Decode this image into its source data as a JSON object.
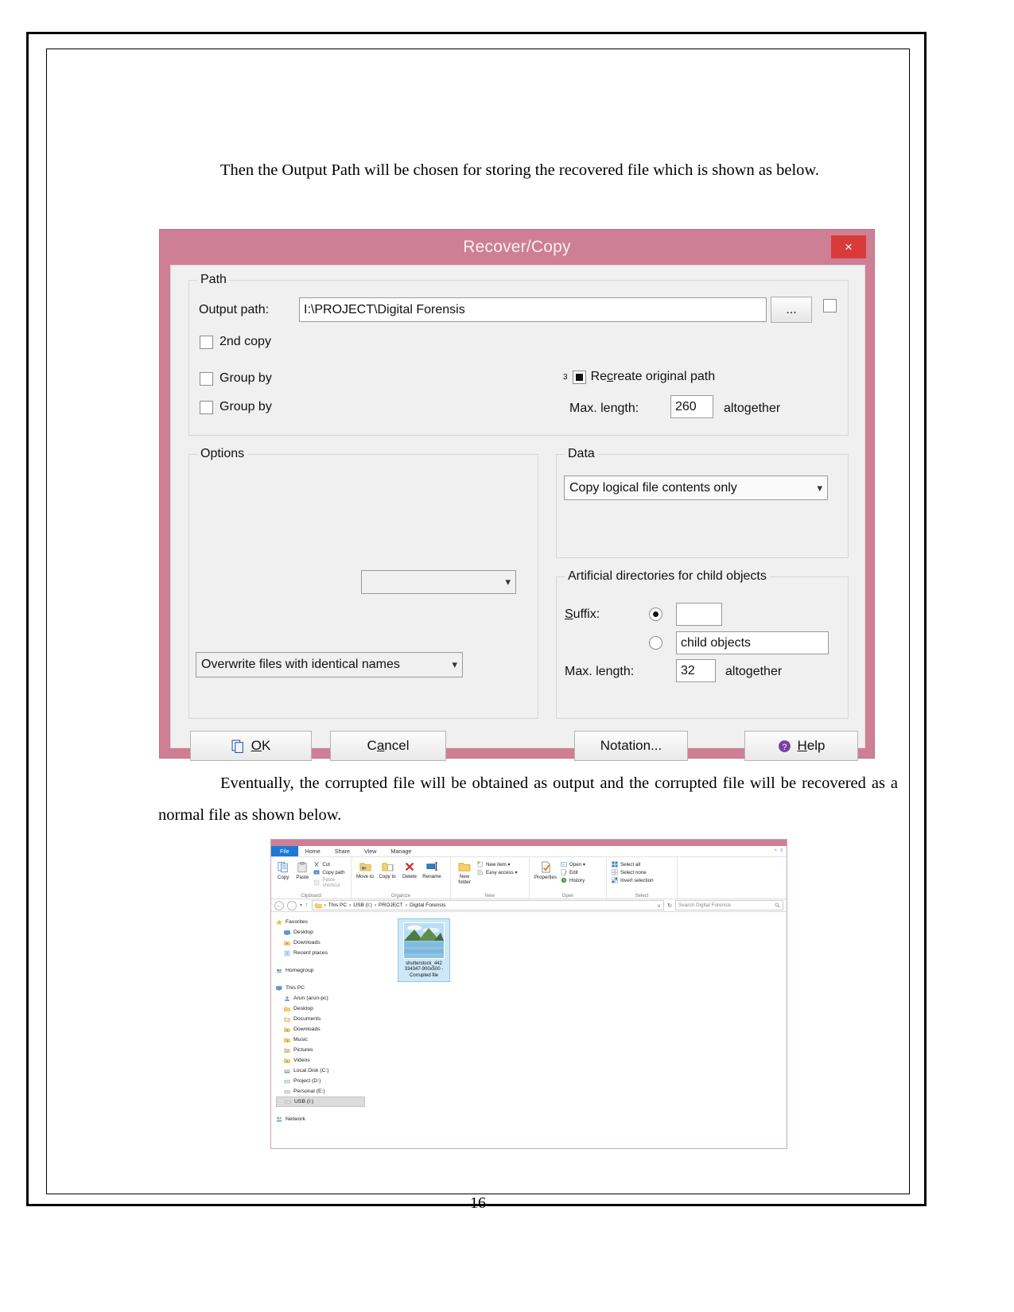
{
  "document": {
    "paragraph1_indent": "",
    "paragraph1": "Then the Output Path will be chosen for storing the recovered file which is shown as below.",
    "paragraph2": "Eventually, the corrupted file will be obtained as output and the corrupted file will be recovered as a normal file as shown below.",
    "page_number": "16"
  },
  "dialog": {
    "title": "Recover/Copy",
    "close_label": "×",
    "titlebar_color": "#cf7f95",
    "close_color": "#d93b3b",
    "path_group": {
      "label": "Path",
      "output_path_label": "Output path:",
      "output_path_value": "I:\\PROJECT\\Digital Forensis",
      "browse_label": "...",
      "second_copy_label": "2nd copy",
      "group_by_label_1": "Group by",
      "group_by_label_2": "Group by",
      "recreate_superscript": "3",
      "recreate_label": "Recreate original path",
      "recreate_label_prefix": "Re",
      "recreate_label_accel": "c",
      "recreate_label_suffix": "reate original path",
      "max_length_label": "Max. length:",
      "max_length_value": "260",
      "altogether_label": "altogether"
    },
    "options_group": {
      "label": "Options",
      "empty_combo_value": "",
      "overwrite_combo_value": "Overwrite files with identical names"
    },
    "data_group": {
      "label": "Data",
      "copy_mode_value": "Copy logical file contents only"
    },
    "artificial_group": {
      "label": "Artificial directories for child objects",
      "suffix_label": "Suffix:",
      "suffix_label_accel": "S",
      "suffix_label_rest": "uffix:",
      "suffix_value": "",
      "child_objects_value": "child objects",
      "max_length_label": "Max. length:",
      "max_length_value": "32",
      "altogether_label": "altogether"
    },
    "buttons": {
      "ok": "OK",
      "ok_accel": "O",
      "ok_rest": "K",
      "cancel": "Cancel",
      "cancel_pre": "C",
      "cancel_accel": "a",
      "cancel_rest": "ncel",
      "notation": "Notation...",
      "help": "Help",
      "help_accel": "H",
      "help_rest": "elp"
    }
  },
  "explorer": {
    "tabs": [
      {
        "label": "File",
        "state": "file"
      },
      {
        "label": "Home",
        "state": "active"
      },
      {
        "label": "Share",
        "state": "normal"
      },
      {
        "label": "View",
        "state": "normal"
      },
      {
        "label": "Manage",
        "state": "contextual"
      }
    ],
    "ribbon_groups": [
      {
        "name": "Clipboard",
        "big": [
          {
            "label": "Copy",
            "icon": "copy-icon"
          },
          {
            "label": "Paste",
            "icon": "paste-icon"
          }
        ],
        "small": [
          {
            "label": "Cut",
            "icon": "cut-icon"
          },
          {
            "label": "Copy path",
            "icon": "copy-path-icon"
          },
          {
            "label": "Paste shortcut",
            "icon": "paste-shortcut-icon"
          }
        ]
      },
      {
        "name": "Organize",
        "big": [
          {
            "label": "Move to",
            "icon": "move-to-icon"
          },
          {
            "label": "Copy to",
            "icon": "copy-to-icon"
          },
          {
            "label": "Delete",
            "icon": "delete-icon"
          },
          {
            "label": "Rename",
            "icon": "rename-icon"
          }
        ],
        "small": []
      },
      {
        "name": "New",
        "big": [
          {
            "label": "New folder",
            "icon": "new-folder-icon"
          }
        ],
        "small": [
          {
            "label": "New item ▾",
            "icon": "new-item-icon"
          },
          {
            "label": "Easy access ▾",
            "icon": "easy-access-icon"
          }
        ]
      },
      {
        "name": "Open",
        "big": [
          {
            "label": "Properties",
            "icon": "properties-icon"
          }
        ],
        "small": [
          {
            "label": "Open ▾",
            "icon": "open-icon"
          },
          {
            "label": "Edit",
            "icon": "edit-icon"
          },
          {
            "label": "History",
            "icon": "history-icon"
          }
        ]
      },
      {
        "name": "Select",
        "big": [],
        "small": [
          {
            "label": "Select all",
            "icon": "select-all-icon"
          },
          {
            "label": "Select none",
            "icon": "select-none-icon"
          },
          {
            "label": "Invert selection",
            "icon": "invert-selection-icon"
          }
        ]
      }
    ],
    "address": {
      "back_label": "←",
      "forward_label": "→",
      "recent_label": "▾",
      "up_label": "↑",
      "breadcrumbs": [
        "This PC",
        "USB (I:)",
        "PROJECT",
        "Digital Forensis"
      ],
      "separator": "›",
      "dropdown_label": "∨",
      "refresh_label": "↻",
      "search_placeholder": "Search Digital Forensis",
      "search_icon": "search-icon"
    },
    "nav_tree": [
      {
        "label": "Favorites",
        "icon": "star-icon",
        "level": 0,
        "selected": false
      },
      {
        "label": "Desktop",
        "icon": "desktop-icon",
        "level": 1,
        "selected": false
      },
      {
        "label": "Downloads",
        "icon": "downloads-icon",
        "level": 1,
        "selected": false
      },
      {
        "label": "Recent places",
        "icon": "recent-places-icon",
        "level": 1,
        "selected": false
      },
      {
        "label": "Homegroup",
        "icon": "homegroup-icon",
        "level": 0,
        "selected": false
      },
      {
        "label": "This PC",
        "icon": "this-pc-icon",
        "level": 0,
        "selected": false
      },
      {
        "label": "Arun (arun-pc)",
        "icon": "user-icon",
        "level": 1,
        "selected": false
      },
      {
        "label": "Desktop",
        "icon": "desktop-icon",
        "level": 1,
        "selected": false
      },
      {
        "label": "Documents",
        "icon": "documents-icon",
        "level": 1,
        "selected": false
      },
      {
        "label": "Downloads",
        "icon": "downloads-icon",
        "level": 1,
        "selected": false
      },
      {
        "label": "Music",
        "icon": "music-icon",
        "level": 1,
        "selected": false
      },
      {
        "label": "Pictures",
        "icon": "pictures-icon",
        "level": 1,
        "selected": false
      },
      {
        "label": "Videos",
        "icon": "videos-icon",
        "level": 1,
        "selected": false
      },
      {
        "label": "Local Disk (C:)",
        "icon": "local-disk-icon",
        "level": 1,
        "selected": false
      },
      {
        "label": "Project (D:)",
        "icon": "drive-icon",
        "level": 1,
        "selected": false
      },
      {
        "label": "Personal (E:)",
        "icon": "drive-icon",
        "level": 1,
        "selected": false
      },
      {
        "label": "USB (I:)",
        "icon": "usb-drive-icon",
        "level": 1,
        "selected": true
      },
      {
        "label": "Network",
        "icon": "network-icon",
        "level": 0,
        "selected": false
      }
    ],
    "files": [
      {
        "name_line1": "shutterstock_442",
        "name_line2": "334347-900x500 -",
        "name_line3": "Corrupted file",
        "selected": true,
        "thumbnail": "landscape-photo"
      }
    ],
    "window_controls": {
      "collapse_ribbon": "^",
      "help": "?"
    }
  }
}
